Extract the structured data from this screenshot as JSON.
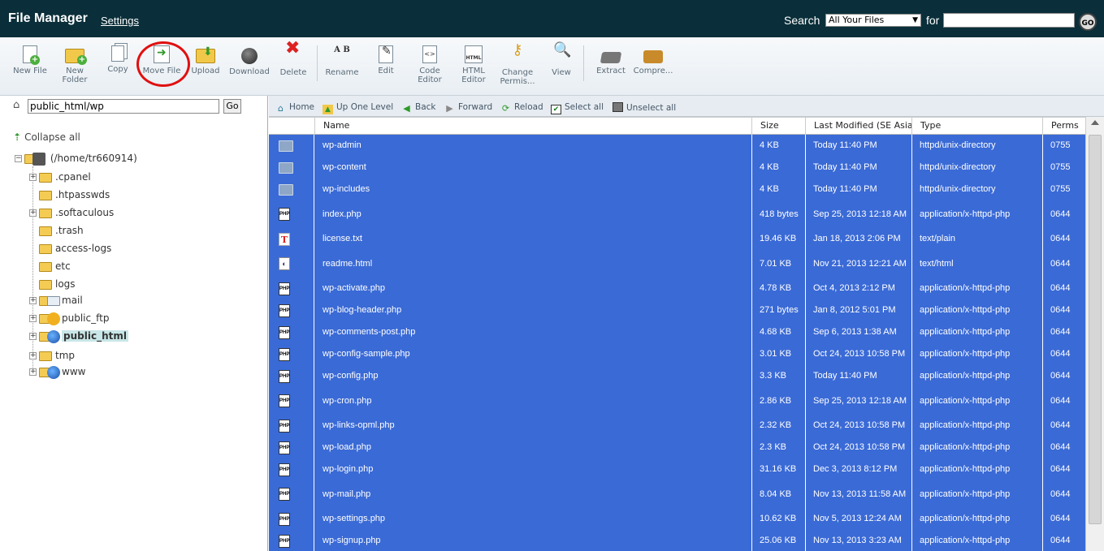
{
  "header": {
    "title": "File Manager",
    "settings_label": "Settings",
    "search_label": "Search",
    "search_scope": "All Your Files",
    "for_label": "for",
    "search_value": "",
    "go_label": "GO"
  },
  "toolbar": [
    {
      "label": "New File",
      "icon": "new-file-icon"
    },
    {
      "label": "New Folder",
      "icon": "new-folder-icon"
    },
    {
      "label": "Copy",
      "icon": "copy-icon"
    },
    {
      "label": "Move File",
      "icon": "move-file-icon"
    },
    {
      "label": "Upload",
      "icon": "upload-icon"
    },
    {
      "label": "Download",
      "icon": "download-icon"
    },
    {
      "label": "Delete",
      "icon": "delete-icon"
    },
    {
      "label": "Rename",
      "icon": "rename-icon"
    },
    {
      "label": "Edit",
      "icon": "edit-icon"
    },
    {
      "label": "Code Editor",
      "icon": "code-editor-icon"
    },
    {
      "label": "HTML Editor",
      "icon": "html-editor-icon"
    },
    {
      "label": "Change Permis...",
      "icon": "key-icon"
    },
    {
      "label": "View",
      "icon": "magnifier-icon"
    },
    {
      "label": "Extract",
      "icon": "extract-icon"
    },
    {
      "label": "Compre...",
      "icon": "compress-icon"
    }
  ],
  "toolbar_icon_text": {
    "rename": "A B",
    "code": "<>",
    "html": "HTML"
  },
  "left_pane": {
    "path_value": "public_html/wp",
    "go_label": "Go",
    "collapse_label": "Collapse all",
    "root_label": "(/home/tr660914)",
    "tree": [
      {
        "label": ".cpanel",
        "expandable": true
      },
      {
        "label": ".htpasswds",
        "expandable": false
      },
      {
        "label": ".softaculous",
        "expandable": true
      },
      {
        "label": ".trash",
        "expandable": false
      },
      {
        "label": "access-logs",
        "expandable": false
      },
      {
        "label": "etc",
        "expandable": false
      },
      {
        "label": "logs",
        "expandable": false
      },
      {
        "label": "mail",
        "expandable": true
      },
      {
        "label": "public_ftp",
        "expandable": true
      },
      {
        "label": "public_html",
        "expandable": true,
        "selected": true
      },
      {
        "label": "tmp",
        "expandable": true
      },
      {
        "label": "www",
        "expandable": true
      }
    ]
  },
  "nav_bar": {
    "home": "Home",
    "up": "Up One Level",
    "back": "Back",
    "forward": "Forward",
    "reload": "Reload",
    "select_all": "Select all",
    "unselect_all": "Unselect all"
  },
  "file_table": {
    "columns": [
      "Name",
      "Size",
      "Last Modified (SE Asia S",
      "Type",
      "Perms"
    ],
    "selection_color": "#3a6ad6",
    "rows": [
      {
        "name": "wp-admin",
        "size": "4 KB",
        "modified": "Today 11:40 PM",
        "type": "httpd/unix-directory",
        "perms": "0755",
        "icon": "dir"
      },
      {
        "name": "wp-content",
        "size": "4 KB",
        "modified": "Today 11:40 PM",
        "type": "httpd/unix-directory",
        "perms": "0755",
        "icon": "dir"
      },
      {
        "name": "wp-includes",
        "size": "4 KB",
        "modified": "Today 11:40 PM",
        "type": "httpd/unix-directory",
        "perms": "0755",
        "icon": "dir"
      },
      {
        "name": "index.php",
        "size": "418 bytes",
        "modified": "Sep 25, 2013 12:18 AM",
        "type": "application/x-httpd-php",
        "perms": "0644",
        "icon": "php"
      },
      {
        "name": "license.txt",
        "size": "19.46 KB",
        "modified": "Jan 18, 2013 2:06 PM",
        "type": "text/plain",
        "perms": "0644",
        "icon": "txt"
      },
      {
        "name": "readme.html",
        "size": "7.01 KB",
        "modified": "Nov 21, 2013 12:21 AM",
        "type": "text/html",
        "perms": "0644",
        "icon": "html"
      },
      {
        "name": "wp-activate.php",
        "size": "4.78 KB",
        "modified": "Oct 4, 2013 2:12 PM",
        "type": "application/x-httpd-php",
        "perms": "0644",
        "icon": "php"
      },
      {
        "name": "wp-blog-header.php",
        "size": "271 bytes",
        "modified": "Jan 8, 2012 5:01 PM",
        "type": "application/x-httpd-php",
        "perms": "0644",
        "icon": "php"
      },
      {
        "name": "wp-comments-post.php",
        "size": "4.68 KB",
        "modified": "Sep 6, 2013 1:38 AM",
        "type": "application/x-httpd-php",
        "perms": "0644",
        "icon": "php"
      },
      {
        "name": "wp-config-sample.php",
        "size": "3.01 KB",
        "modified": "Oct 24, 2013 10:58 PM",
        "type": "application/x-httpd-php",
        "perms": "0644",
        "icon": "php"
      },
      {
        "name": "wp-config.php",
        "size": "3.3 KB",
        "modified": "Today 11:40 PM",
        "type": "application/x-httpd-php",
        "perms": "0644",
        "icon": "php"
      },
      {
        "name": "wp-cron.php",
        "size": "2.86 KB",
        "modified": "Sep 25, 2013 12:18 AM",
        "type": "application/x-httpd-php",
        "perms": "0644",
        "icon": "php"
      },
      {
        "name": "wp-links-opml.php",
        "size": "2.32 KB",
        "modified": "Oct 24, 2013 10:58 PM",
        "type": "application/x-httpd-php",
        "perms": "0644",
        "icon": "php"
      },
      {
        "name": "wp-load.php",
        "size": "2.3 KB",
        "modified": "Oct 24, 2013 10:58 PM",
        "type": "application/x-httpd-php",
        "perms": "0644",
        "icon": "php"
      },
      {
        "name": "wp-login.php",
        "size": "31.16 KB",
        "modified": "Dec 3, 2013 8:12 PM",
        "type": "application/x-httpd-php",
        "perms": "0644",
        "icon": "php"
      },
      {
        "name": "wp-mail.php",
        "size": "8.04 KB",
        "modified": "Nov 13, 2013 11:58 AM",
        "type": "application/x-httpd-php",
        "perms": "0644",
        "icon": "php"
      },
      {
        "name": "wp-settings.php",
        "size": "10.62 KB",
        "modified": "Nov 5, 2013 12:24 AM",
        "type": "application/x-httpd-php",
        "perms": "0644",
        "icon": "php"
      },
      {
        "name": "wp-signup.php",
        "size": "25.06 KB",
        "modified": "Nov 13, 2013 3:23 AM",
        "type": "application/x-httpd-php",
        "perms": "0644",
        "icon": "php"
      }
    ]
  }
}
